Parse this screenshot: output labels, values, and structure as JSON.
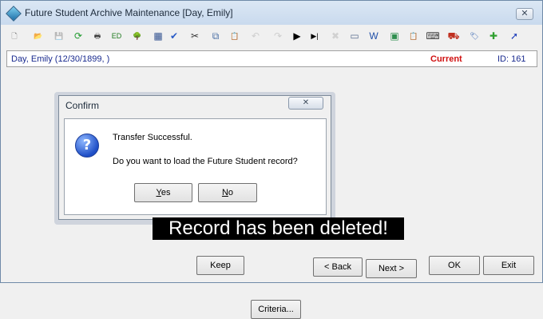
{
  "window": {
    "title": "Future Student Archive Maintenance  [Day, Emily]",
    "close_label": "✕"
  },
  "toolbar": {
    "icons": [
      {
        "name": "new-icon",
        "glyph": "🗋",
        "color": "#6a6a6a",
        "enabled": true
      },
      {
        "name": "open-folder-icon",
        "glyph": "📂",
        "color": "#d9a21b",
        "enabled": true
      },
      {
        "name": "save-icon",
        "glyph": "💾",
        "color": "#6a6a6a",
        "enabled": false
      },
      {
        "name": "refresh-icon",
        "glyph": "⟳",
        "color": "#1f9a2e",
        "enabled": true
      },
      {
        "name": "print-icon",
        "glyph": "🖶",
        "color": "#404040",
        "enabled": true
      },
      {
        "name": "edit-icon",
        "glyph": "ED",
        "color": "#1e7a1e",
        "enabled": true
      },
      {
        "name": "tree-icon",
        "glyph": "🌳",
        "color": "#2e8b2e",
        "enabled": true
      },
      {
        "name": "calculator-icon",
        "glyph": "▦",
        "color": "#30508f",
        "enabled": true
      },
      {
        "name": "spellcheck-icon",
        "glyph": "✔",
        "color": "#2a5cc7",
        "enabled": true
      },
      {
        "name": "cut-icon",
        "glyph": "✂",
        "color": "#303030",
        "enabled": true
      },
      {
        "name": "copy-icon",
        "glyph": "⧉",
        "color": "#4a6fa5",
        "enabled": true
      },
      {
        "name": "paste-icon",
        "glyph": "📋",
        "color": "#b08030",
        "enabled": true
      },
      {
        "name": "undo-icon",
        "glyph": "↶",
        "color": "#909090",
        "enabled": false
      },
      {
        "name": "redo-icon",
        "glyph": "↷",
        "color": "#909090",
        "enabled": false
      },
      {
        "name": "play-icon",
        "glyph": "▶",
        "color": "#000000",
        "enabled": true
      },
      {
        "name": "play-end-icon",
        "glyph": "▶|",
        "color": "#000000",
        "enabled": true
      },
      {
        "name": "delete-icon",
        "glyph": "✖",
        "color": "#9a9a9a",
        "enabled": false
      },
      {
        "name": "card-icon",
        "glyph": "▭",
        "color": "#5a6f8f",
        "enabled": true
      },
      {
        "name": "word-icon",
        "glyph": "W",
        "color": "#1f4fa8",
        "enabled": true
      },
      {
        "name": "grid-icon",
        "glyph": "▣",
        "color": "#2f8f4f",
        "enabled": true
      },
      {
        "name": "notes-icon",
        "glyph": "📋",
        "color": "#b08030",
        "enabled": true
      },
      {
        "name": "keyboard-icon",
        "glyph": "⌨",
        "color": "#404040",
        "enabled": true
      },
      {
        "name": "stamp-icon",
        "glyph": "⛟",
        "color": "#c03020",
        "enabled": true
      },
      {
        "name": "tag-icon",
        "glyph": "🏷",
        "color": "#3060b0",
        "enabled": true
      },
      {
        "name": "add-record-icon",
        "glyph": "✚",
        "color": "#2f9f2f",
        "enabled": true
      },
      {
        "name": "arrow-icon",
        "glyph": "➚",
        "color": "#1a3ab8",
        "enabled": true
      }
    ]
  },
  "record_bar": {
    "name": "Day, Emily (12/30/1899, )",
    "status": "Current",
    "id": "ID: 161"
  },
  "dialog": {
    "title": "Confirm",
    "close_label": "✕",
    "icon_glyph": "?",
    "message_1": "Transfer Successful.",
    "message_2": "Do you want to load the Future Student record?",
    "yes_label": "Yes",
    "yes_mnemonic": "Y",
    "no_label": "No",
    "no_mnemonic": "N"
  },
  "banner": {
    "text": "Record has been deleted!"
  },
  "footer": {
    "buttons": [
      {
        "name": "keep-button",
        "label": "Keep"
      },
      {
        "name": "criteria-button",
        "label": "Criteria..."
      },
      {
        "name": "back-button",
        "label": "< Back"
      },
      {
        "name": "next-button",
        "label": "Next >"
      },
      {
        "name": "ok-button",
        "label": "OK"
      },
      {
        "name": "exit-button",
        "label": "Exit"
      }
    ]
  }
}
